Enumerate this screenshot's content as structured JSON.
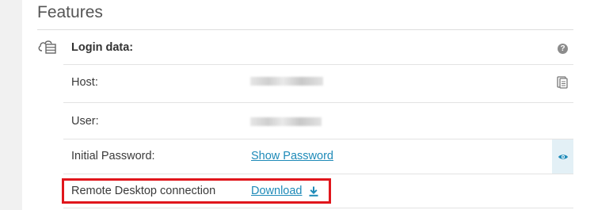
{
  "section": {
    "title": "Features"
  },
  "login": {
    "header": "Login data:",
    "help_glyph": "?",
    "rows": [
      {
        "label": "Host:",
        "value_state": "redacted"
      },
      {
        "label": "User:",
        "value_state": "redacted"
      },
      {
        "label": "Initial Password:",
        "link": "Show Password"
      },
      {
        "label": "Remote Desktop connection",
        "link": "Download"
      }
    ]
  },
  "icons": {
    "section": "cloud-server-icon",
    "help": "help-circle-icon",
    "copy": "copy-clipboard-icon",
    "reveal": "eye-icon",
    "download": "download-icon"
  },
  "colors": {
    "link": "#1e8ab8",
    "highlight": "#e0161c",
    "reveal_bg": "#e3f0f6"
  }
}
